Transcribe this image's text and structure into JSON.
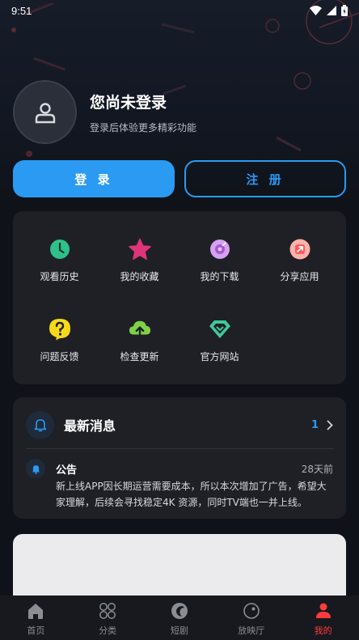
{
  "status_bar": {
    "time": "9:51"
  },
  "profile": {
    "name": "您尚未登录",
    "subtitle": "登录后体验更多精彩功能"
  },
  "buttons": {
    "login": "登 录",
    "register": "注 册"
  },
  "grid": [
    {
      "label": "观看历史",
      "icon": "clock-icon",
      "color": "#2ec18a"
    },
    {
      "label": "我的收藏",
      "icon": "star-icon",
      "color": "#e0347a"
    },
    {
      "label": "我的下载",
      "icon": "download-icon",
      "color": "#c88de8"
    },
    {
      "label": "分享应用",
      "icon": "share-icon",
      "color": "#ff8a8a"
    },
    {
      "label": "问题反馈",
      "icon": "question-icon",
      "color": "#f7d91a"
    },
    {
      "label": "检查更新",
      "icon": "cloud-upload-icon",
      "color": "#7fd046"
    },
    {
      "label": "官方网站",
      "icon": "diamond-icon",
      "color": "#3fc89a"
    }
  ],
  "messages": {
    "title": "最新消息",
    "count": "1",
    "notice": {
      "title": "公告",
      "time": "28天前",
      "body": "新上线APP因长期运营需要成本，所以本次增加了广告，希望大家理解，后续会寻找稳定4K 资源，同时TV端也一并上线。"
    }
  },
  "bottom_nav": [
    {
      "label": "首页",
      "icon": "home-icon"
    },
    {
      "label": "分类",
      "icon": "category-icon"
    },
    {
      "label": "短剧",
      "icon": "short-drama-icon"
    },
    {
      "label": "放映厅",
      "icon": "theater-icon"
    },
    {
      "label": "我的",
      "icon": "profile-icon",
      "active": true
    }
  ],
  "colors": {
    "accent": "#2a9af3",
    "active_tab": "#ff3b3b",
    "card": "#1e2026"
  }
}
